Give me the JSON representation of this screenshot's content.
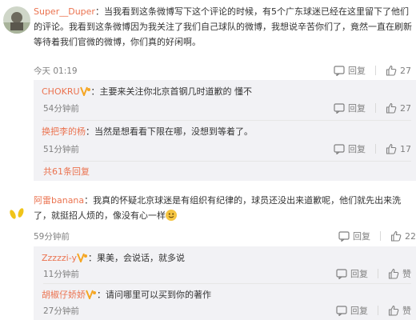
{
  "comments": [
    {
      "username": "Super__Duper",
      "text": "：当我看到这条微博写下这个评论的时候，有5个广东球迷已经在这里留下了他们的评论。我看到这条微博因为我关注了我们自己球队的微博，我想说辛苦你们了，竟然一直在刷新等待着我们官微的微博，你们真的好闲啊。",
      "time": "今天 01:19",
      "actions": {
        "reply": "回复",
        "like_count": "27"
      },
      "replies": [
        {
          "username": "CHOKRU",
          "text": "：主要来关注你北京首钢几时道歉的 懂不",
          "time": "54分钟前",
          "actions": {
            "reply": "回复",
            "like_count": "27"
          }
        },
        {
          "username": "换把李的杨",
          "text": "：当然是想看看下限在哪，没想到等着了。",
          "time": "51分钟前",
          "actions": {
            "reply": "回复",
            "like_count": "17"
          }
        }
      ],
      "more_replies": "共61条回复"
    },
    {
      "username": "阿雷banana",
      "text": "：我真的怀疑北京球迷是有组织有纪律的，球员还没出来道歉呢，他们就先出来洗了，就挺招人烦的，像没有心一样",
      "time": "59分钟前",
      "actions": {
        "reply": "回复",
        "like_count": "22"
      },
      "replies": [
        {
          "username": "Zzzzzi-y",
          "text": "：果美，会说话，就多说",
          "time": "11分钟前",
          "actions": {
            "reply": "回复",
            "like_count": "赞"
          }
        },
        {
          "username": "胡椒仔娇娇",
          "text": "：请问哪里可以买到你的著作",
          "time": "27分钟前",
          "actions": {
            "reply": "回复",
            "like_count": "赞"
          }
        }
      ]
    }
  ],
  "colors": {
    "username": "#eb7350",
    "reply_bg": "#f2f2f5",
    "meta": "#808080"
  },
  "icons": [
    "reply-icon",
    "like-icon",
    "vip-icon",
    "smile-emoji-icon"
  ]
}
